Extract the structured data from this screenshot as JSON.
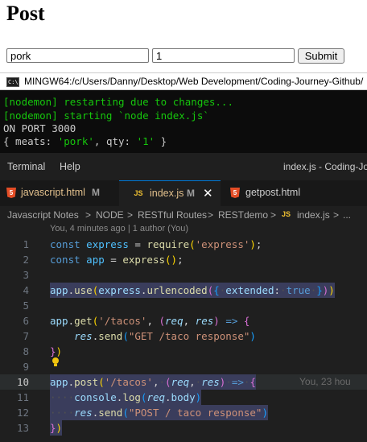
{
  "web": {
    "title": "Post",
    "meat_value": "pork",
    "qty_value": "1",
    "submit_label": "Submit"
  },
  "terminal": {
    "title": "MINGW64:/c/Users/Danny/Desktop/Web Development/Coding-Journey-Github/",
    "icon_label": "C:\\",
    "lines": [
      "[nodemon] restarting due to changes...",
      "[nodemon] starting `node index.js`",
      "ON PORT 3000",
      "{ meats: 'pork', qty: '1' }"
    ],
    "colors": {
      "nodemon": "#16c60c",
      "default": "#cccccc",
      "string": "#16c60c"
    }
  },
  "vscode": {
    "menu": [
      "Terminal",
      "Help"
    ],
    "window_title": "index.js - Coding-Jo",
    "tabs": [
      {
        "label": "javascript.html",
        "modified": "M",
        "icon": "html5-icon",
        "active": false
      },
      {
        "label": "index.js",
        "modified": "M",
        "icon": "js-icon",
        "active": true
      },
      {
        "label": "getpost.html",
        "modified": "",
        "icon": "html5-icon",
        "active": false
      }
    ],
    "breadcrumb": [
      "Javascript Notes",
      "NODE",
      "RESTful Routes",
      "RESTdemo",
      "index.js",
      "..."
    ],
    "blame_header": "You, 4 minutes ago | 1 author (You)",
    "inline_blame": "You, 23 hou",
    "line_numbers": [
      "1",
      "2",
      "3",
      "4",
      "5",
      "6",
      "7",
      "8",
      "9",
      "10",
      "11",
      "12",
      "13"
    ],
    "current_line": "10",
    "code_text": {
      "l1_kw": "const",
      "l1_var": "express",
      "l1_eq": " = ",
      "l1_fn": "require",
      "l1_str": "'express'",
      "l2_kw": "const",
      "l2_var": "app",
      "l2_eq": " = ",
      "l2_fn": "express",
      "l4_app": "app",
      "l4_use": "use",
      "l4_ex": "express",
      "l4_fn": "urlencoded",
      "l4_key": "extended",
      "l4_bool": "true",
      "l6_app": "app",
      "l6_fn": "get",
      "l6_str": "'/tacos'",
      "l6_p1": "req",
      "l6_p2": "res",
      "l7_res": "res",
      "l7_fn": "send",
      "l7_str": "\"GET /taco response\"",
      "l10_app": "app",
      "l10_fn": "post",
      "l10_str": "'/tacos'",
      "l10_p1": "req",
      "l10_p2": "res",
      "l11_console": "console",
      "l11_fn": "log",
      "l11_req": "req",
      "l11_prop": "body",
      "l12_res": "res",
      "l12_fn": "send",
      "l12_str": "\"POST / taco response\""
    }
  }
}
